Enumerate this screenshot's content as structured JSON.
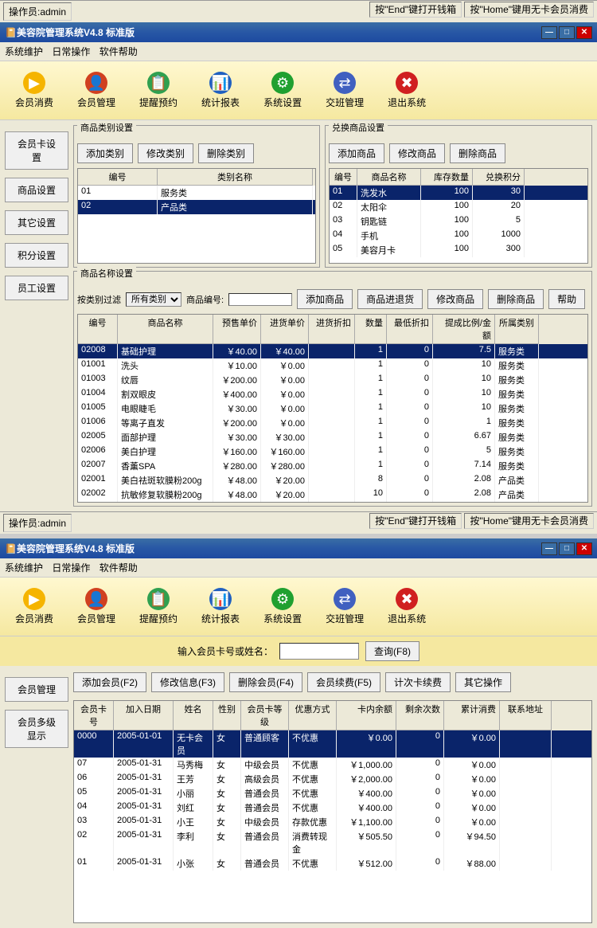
{
  "app1": {
    "status_left": "操作员:admin",
    "status_right1": "按\"End\"键打开钱箱",
    "status_right2": "按\"Home\"键用无卡会员消费",
    "title": "美容院管理系统V4.8 标准版",
    "menu": [
      "系统维护",
      "日常操作",
      "软件帮助"
    ],
    "toolbar": [
      {
        "label": "会员消费",
        "icon": "▶",
        "color": "#f5b400"
      },
      {
        "label": "会员管理",
        "icon": "👤",
        "color": "#d04020"
      },
      {
        "label": "提醒预约",
        "icon": "📋",
        "color": "#30a050"
      },
      {
        "label": "统计报表",
        "icon": "📊",
        "color": "#2060c0"
      },
      {
        "label": "系统设置",
        "icon": "⚙",
        "color": "#20a030"
      },
      {
        "label": "交班管理",
        "icon": "⇄",
        "color": "#4060c0"
      },
      {
        "label": "退出系统",
        "icon": "✖",
        "color": "#d02020"
      }
    ],
    "side": [
      "会员卡设置",
      "商品设置",
      "其它设置",
      "积分设置",
      "员工设置"
    ],
    "category_panel": {
      "title": "商品类别设置",
      "buttons": [
        "添加类别",
        "修改类别",
        "删除类别"
      ],
      "cols": [
        "编号",
        "类别名称"
      ],
      "rows": [
        {
          "id": "01",
          "name": "服务类",
          "selected": false
        },
        {
          "id": "02",
          "name": "产品类",
          "selected": true
        }
      ]
    },
    "exchange_panel": {
      "title": "兑换商品设置",
      "buttons": [
        "添加商品",
        "修改商品",
        "删除商品"
      ],
      "cols": [
        "编号",
        "商品名称",
        "库存数量",
        "兑换积分"
      ],
      "rows": [
        {
          "id": "01",
          "name": "洗发水",
          "stock": "100",
          "points": "30",
          "selected": true
        },
        {
          "id": "02",
          "name": "太阳伞",
          "stock": "100",
          "points": "20",
          "selected": false
        },
        {
          "id": "03",
          "name": "钥匙链",
          "stock": "100",
          "points": "5",
          "selected": false
        },
        {
          "id": "04",
          "name": "手机",
          "stock": "100",
          "points": "1000",
          "selected": false
        },
        {
          "id": "05",
          "name": "美容月卡",
          "stock": "100",
          "points": "300",
          "selected": false
        }
      ]
    },
    "name_panel": {
      "title": "商品名称设置",
      "filter_label": "按类别过滤",
      "filter_value": "所有类别",
      "code_label": "商品编号:",
      "code_value": "",
      "buttons": [
        "添加商品",
        "商品进退货",
        "修改商品",
        "删除商品",
        "帮助"
      ],
      "cols": [
        "编号",
        "商品名称",
        "预售单价",
        "进货单价",
        "进货折扣",
        "数量",
        "最低折扣",
        "提成比例/金额",
        "所属类别"
      ],
      "rows": [
        {
          "c": [
            "02008",
            "基础护理",
            "￥40.00",
            "￥40.00",
            "",
            "1",
            "0",
            "7.5",
            "服务类"
          ],
          "selected": true
        },
        {
          "c": [
            "01001",
            "洗头",
            "￥10.00",
            "￥0.00",
            "",
            "1",
            "0",
            "10",
            "服务类"
          ]
        },
        {
          "c": [
            "01003",
            "纹唇",
            "￥200.00",
            "￥0.00",
            "",
            "1",
            "0",
            "10",
            "服务类"
          ]
        },
        {
          "c": [
            "01004",
            "割双眼皮",
            "￥400.00",
            "￥0.00",
            "",
            "1",
            "0",
            "10",
            "服务类"
          ]
        },
        {
          "c": [
            "01005",
            "电眼睫毛",
            "￥30.00",
            "￥0.00",
            "",
            "1",
            "0",
            "10",
            "服务类"
          ]
        },
        {
          "c": [
            "01006",
            "等离子直发",
            "￥200.00",
            "￥0.00",
            "",
            "1",
            "0",
            "1",
            "服务类"
          ]
        },
        {
          "c": [
            "02005",
            "面部护理",
            "￥30.00",
            "￥30.00",
            "",
            "1",
            "0",
            "6.67",
            "服务类"
          ]
        },
        {
          "c": [
            "02006",
            "美白护理",
            "￥160.00",
            "￥160.00",
            "",
            "1",
            "0",
            "5",
            "服务类"
          ]
        },
        {
          "c": [
            "02007",
            "香薰SPA",
            "￥280.00",
            "￥280.00",
            "",
            "1",
            "0",
            "7.14",
            "服务类"
          ]
        },
        {
          "c": [
            "02001",
            "美白祛斑软膜粉200g",
            "￥48.00",
            "￥20.00",
            "",
            "8",
            "0",
            "2.08",
            "产品类"
          ]
        },
        {
          "c": [
            "02002",
            "抗敏修复软膜粉200g",
            "￥48.00",
            "￥20.00",
            "",
            "10",
            "0",
            "2.08",
            "产品类"
          ]
        }
      ]
    }
  },
  "app2": {
    "status_left": "操作员:admin",
    "status_right1": "按\"End\"键打开钱箱",
    "status_right2": "按\"Home\"键用无卡会员消费",
    "title": "美容院管理系统V4.8 标准版",
    "menu": [
      "系统维护",
      "日常操作",
      "软件帮助"
    ],
    "toolbar": [
      {
        "label": "会员消费",
        "icon": "▶",
        "color": "#f5b400"
      },
      {
        "label": "会员管理",
        "icon": "👤",
        "color": "#d04020"
      },
      {
        "label": "提醒预约",
        "icon": "📋",
        "color": "#30a050"
      },
      {
        "label": "统计报表",
        "icon": "📊",
        "color": "#2060c0"
      },
      {
        "label": "系统设置",
        "icon": "⚙",
        "color": "#20a030"
      },
      {
        "label": "交班管理",
        "icon": "⇄",
        "color": "#4060c0"
      },
      {
        "label": "退出系统",
        "icon": "✖",
        "color": "#d02020"
      }
    ],
    "query_label": "输入会员卡号或姓名：",
    "query_value": "",
    "query_btn": "查询(F8)",
    "side": [
      "会员管理",
      "会员多级显示"
    ],
    "action_btns": [
      "添加会员(F2)",
      "修改信息(F3)",
      "删除会员(F4)",
      "会员续费(F5)",
      "计次卡续费",
      "其它操作"
    ],
    "member_cols": [
      "会员卡号",
      "加入日期",
      "姓名",
      "性别",
      "会员卡等级",
      "优惠方式",
      "卡内余额",
      "剩余次数",
      "累计消费",
      "联系地址"
    ],
    "member_rows": [
      {
        "c": [
          "0000",
          "2005-01-01",
          "无卡会员",
          "女",
          "普通顾客",
          "不优惠",
          "￥0.00",
          "0",
          "￥0.00",
          ""
        ],
        "selected": true
      },
      {
        "c": [
          "07",
          "2005-01-31",
          "马秀梅",
          "女",
          "中级会员",
          "不优惠",
          "￥1,000.00",
          "0",
          "￥0.00",
          ""
        ]
      },
      {
        "c": [
          "06",
          "2005-01-31",
          "王芳",
          "女",
          "高级会员",
          "不优惠",
          "￥2,000.00",
          "0",
          "￥0.00",
          ""
        ]
      },
      {
        "c": [
          "05",
          "2005-01-31",
          "小丽",
          "女",
          "普通会员",
          "不优惠",
          "￥400.00",
          "0",
          "￥0.00",
          ""
        ]
      },
      {
        "c": [
          "04",
          "2005-01-31",
          "刘红",
          "女",
          "普通会员",
          "不优惠",
          "￥400.00",
          "0",
          "￥0.00",
          ""
        ]
      },
      {
        "c": [
          "03",
          "2005-01-31",
          "小王",
          "女",
          "中级会员",
          "存款优惠",
          "￥1,100.00",
          "0",
          "￥0.00",
          ""
        ]
      },
      {
        "c": [
          "02",
          "2005-01-31",
          "李利",
          "女",
          "普通会员",
          "消费转现金",
          "￥505.50",
          "0",
          "￥94.50",
          ""
        ]
      },
      {
        "c": [
          "01",
          "2005-01-31",
          "小张",
          "女",
          "普通会员",
          "不优惠",
          "￥512.00",
          "0",
          "￥88.00",
          ""
        ]
      }
    ]
  }
}
